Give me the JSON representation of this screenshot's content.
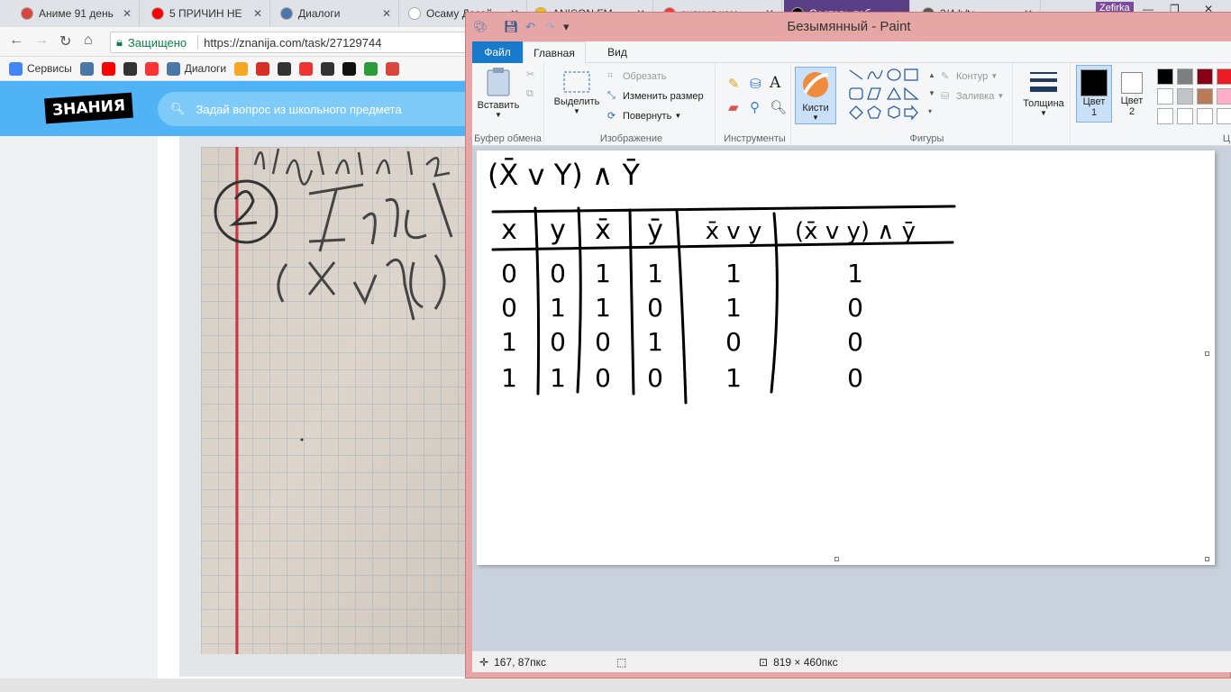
{
  "browser": {
    "tabs": [
      {
        "title": "Аниме 91 день",
        "icon": "anime-icon",
        "color": "#d9453f"
      },
      {
        "title": "5 ПРИЧИН НЕ",
        "icon": "youtube-icon",
        "color": "#ff0000"
      },
      {
        "title": "Диалоги",
        "icon": "dialog-icon",
        "color": "#4a76a8"
      },
      {
        "title": "Осаму Дазай",
        "icon": "wikipedia-icon",
        "color": "#ffffff"
      },
      {
        "title": "ANISON.FM",
        "icon": "anison-icon",
        "color": "#f0c000"
      },
      {
        "title": "знания.ком",
        "icon": "yandex-icon",
        "color": "#f33"
      },
      {
        "title": "Составь таб",
        "icon": "znanija-icon",
        "color": "#000"
      },
      {
        "title": "3/4 b/t+...",
        "icon": "tab-icon",
        "color": "#555"
      }
    ],
    "profile": "Zefirka",
    "secure_label": "Защищено",
    "url": "https://znanija.com/task/27129744",
    "bookmarks": [
      {
        "label": "Сервисы",
        "icon": "apps-icon",
        "color": "#4285f4"
      },
      {
        "label": "",
        "icon": "vk-icon",
        "color": "#4a76a8"
      },
      {
        "label": "",
        "icon": "youtube-icon",
        "color": "#ff0000"
      },
      {
        "label": "",
        "icon": "bookmark-icon",
        "color": "#333"
      },
      {
        "label": "",
        "icon": "yandex-icon",
        "color": "#f33"
      },
      {
        "label": "Диалоги",
        "icon": "dialog-icon",
        "color": "#4a76a8"
      },
      {
        "label": "",
        "icon": "mail-icon",
        "color": "#f5a623"
      },
      {
        "label": "",
        "icon": "gmail-icon",
        "color": "#d93025"
      },
      {
        "label": "",
        "icon": "bookmark-icon",
        "color": "#333"
      },
      {
        "label": "",
        "icon": "bookmark-icon",
        "color": "#e33"
      },
      {
        "label": "",
        "icon": "bookmark-icon",
        "color": "#333"
      },
      {
        "label": "",
        "icon": "bookmark-icon",
        "color": "#111"
      },
      {
        "label": "",
        "icon": "bookmark-icon",
        "color": "#2a9d3a"
      },
      {
        "label": "",
        "icon": "bookmark-icon",
        "color": "#d9453f"
      }
    ]
  },
  "znanija": {
    "logo": "ЗНАНИЯ",
    "search_placeholder": "Задай вопрос из школьного предмета"
  },
  "paint": {
    "title": "Безымянный - Paint",
    "tabs": {
      "file": "Файл",
      "home": "Главная",
      "view": "Вид"
    },
    "clipboard": {
      "paste": "Вставить",
      "group": "Буфер обмена"
    },
    "image": {
      "select": "Выделить",
      "crop": "Обрезать",
      "resize": "Изменить размер",
      "rotate": "Повернуть",
      "group": "Изображение"
    },
    "tools": {
      "group": "Инструменты"
    },
    "brushes": {
      "label": "Кисти"
    },
    "shapes": {
      "outline": "Контур",
      "fill": "Заливка",
      "group": "Фигуры"
    },
    "size": {
      "label": "Толщина"
    },
    "colors": {
      "color1": "Цвет",
      "color1_num": "1",
      "color2": "Цвет",
      "color2_num": "2",
      "group": "Ц"
    },
    "palette": [
      "#000000",
      "#7f7f7f",
      "#880015",
      "#ed1c24",
      "#ffffff",
      "#c3c3c3",
      "#b97a57",
      "#ffaec9",
      "#ffffff",
      "#ffffff",
      "#ffffff",
      "#ffffff"
    ],
    "status": {
      "cursor": "167, 87пкс",
      "size": "819 × 460пкс"
    }
  },
  "drawing": {
    "title": "(X̄ v Y) ∧ Ȳ",
    "headers": [
      "x",
      "y",
      "x̄",
      "ȳ",
      "x̄ v y",
      "(x̄ v y) ∧ ȳ"
    ],
    "rows": [
      [
        "0",
        "0",
        "1",
        "1",
        "1",
        "1"
      ],
      [
        "0",
        "1",
        "1",
        "0",
        "1",
        "0"
      ],
      [
        "1",
        "0",
        "0",
        "1",
        "0",
        "0"
      ],
      [
        "1",
        "1",
        "0",
        "0",
        "1",
        "0"
      ]
    ]
  }
}
